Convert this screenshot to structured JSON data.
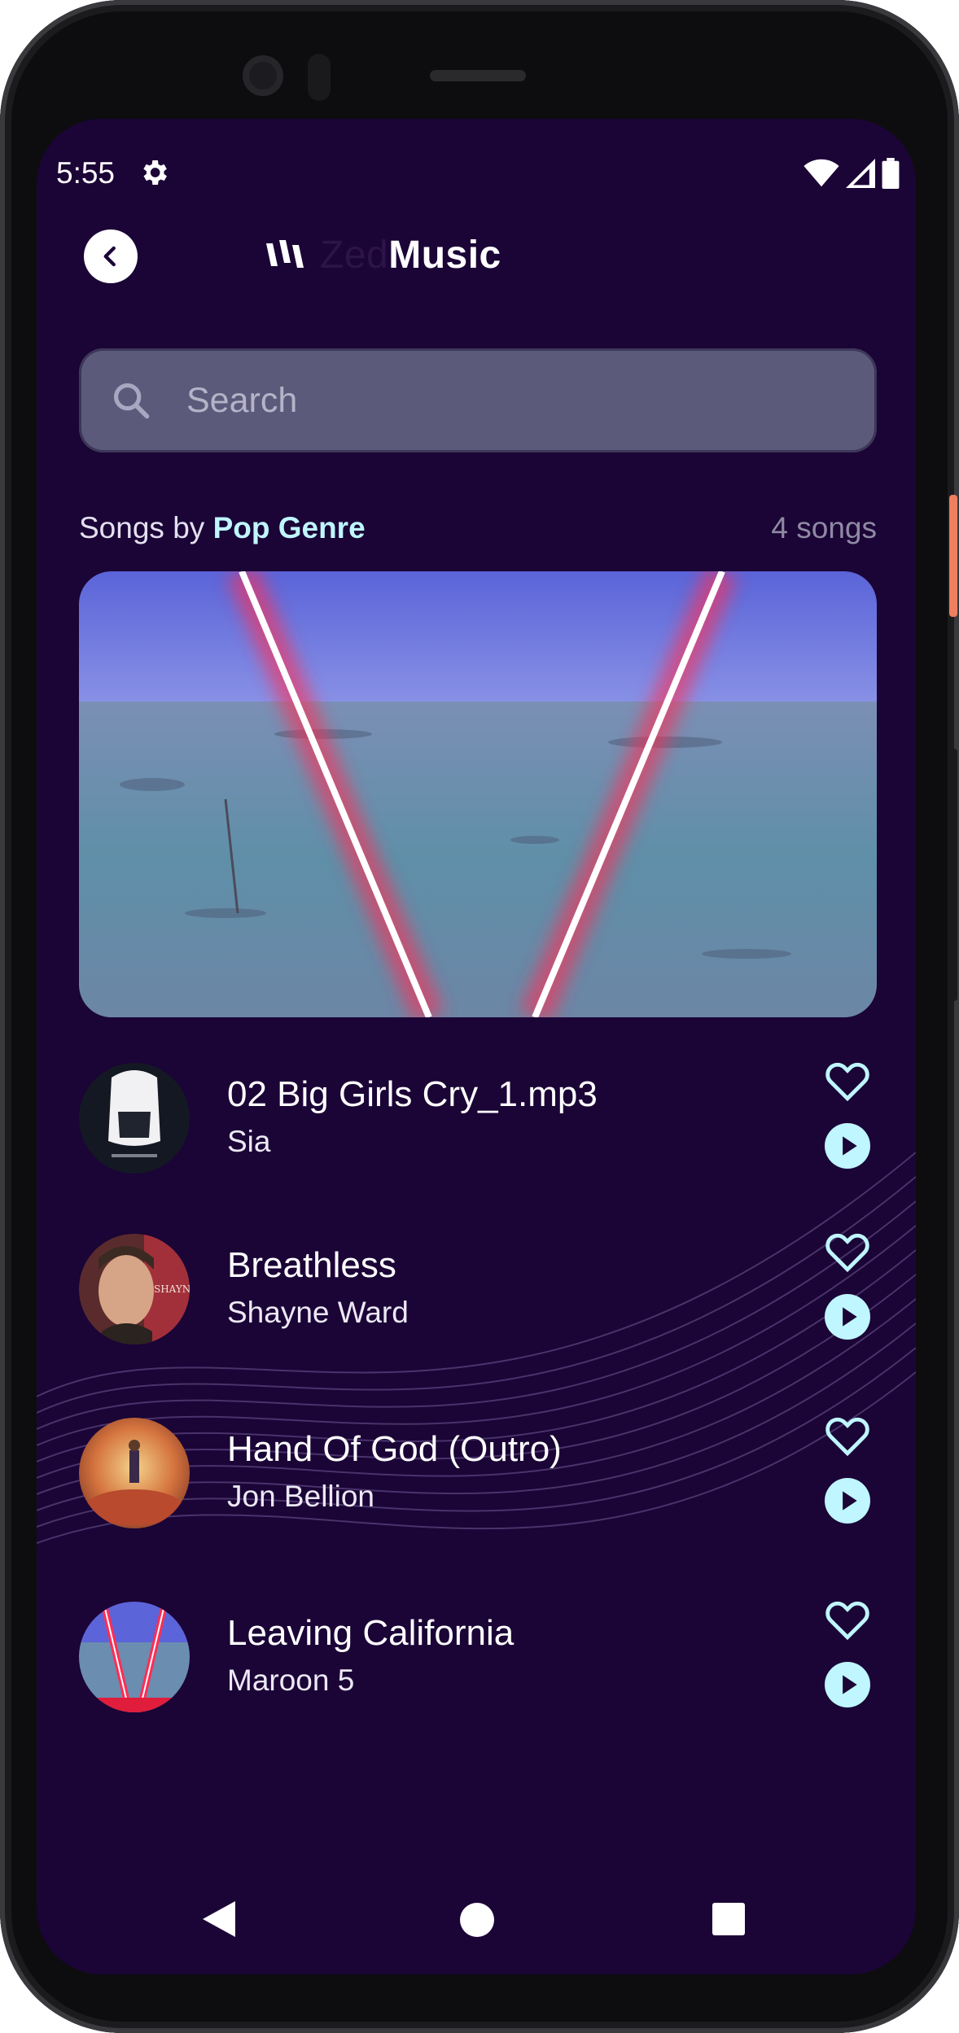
{
  "status_bar": {
    "time": "5:55",
    "icons": [
      "gear-icon",
      "wifi-icon",
      "signal-icon",
      "battery-icon"
    ]
  },
  "header": {
    "back_icon": "chevron-left-icon",
    "logo_prefix": "Zed",
    "logo_suffix": "Music"
  },
  "search": {
    "placeholder": "Search",
    "value": ""
  },
  "section": {
    "prefix": "Songs by ",
    "genre": "Pop Genre",
    "count": "4 songs"
  },
  "songs": [
    {
      "title": "02 Big Girls Cry_1.mp3",
      "artist": "Sia"
    },
    {
      "title": "Breathless",
      "artist": "Shayne Ward"
    },
    {
      "title": "Hand Of God (Outro)",
      "artist": "Jon Bellion"
    },
    {
      "title": "Leaving California",
      "artist": "Maroon 5"
    }
  ],
  "nav": {
    "icons": [
      "back-triangle-icon",
      "home-circle-icon",
      "recents-square-icon"
    ]
  },
  "colors": {
    "background": "#1b0436",
    "accent": "#bff6ff",
    "search_bg": "#5c5a7a",
    "text": "#ffffff"
  }
}
